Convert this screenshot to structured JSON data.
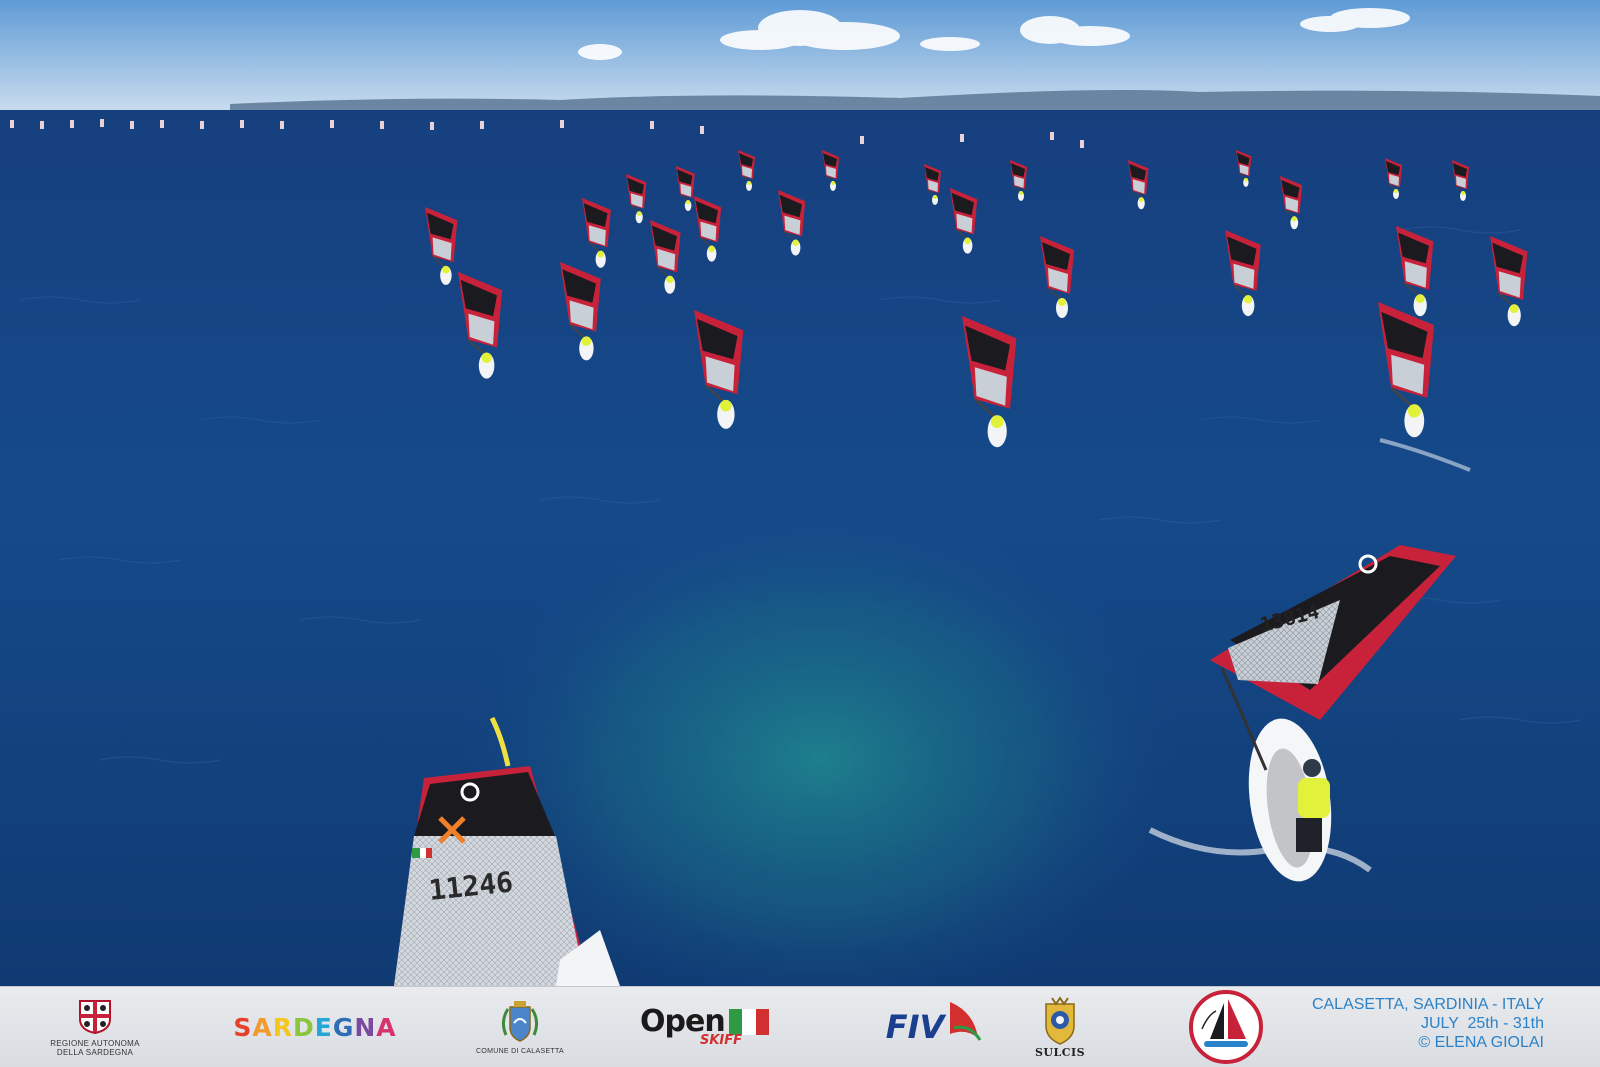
{
  "photo": {
    "subject": "aerial-view-of-windsurf-fleet-racing-on-open-sea",
    "colors": {
      "sky": "#7fb2df",
      "sea_deep": "#123f7a",
      "sea_shallow": "#1d7a86",
      "sail_red": "#c8223a",
      "sail_dark": "#1b1b1f",
      "jersey": "#e2f23a"
    },
    "near_sail_numbers": [
      "11246",
      "13814"
    ]
  },
  "banner": {
    "logos": {
      "region_line1": "REGIONE AUTONOMA",
      "region_line2": "DELLA SARDEGNA",
      "sardegna_letters": [
        "S",
        "A",
        "R",
        "D",
        "E",
        "G",
        "N",
        "A"
      ],
      "comune": "COMUNE DI CALASETTA",
      "open_word": "Open",
      "skiff_word": "SKIFF",
      "fiv": "FIV",
      "sulcis": "SULCIS",
      "championship_icon": "world-championship-badge-icon"
    },
    "event": {
      "location": "CALASETTA, SARDINIA - ITALY",
      "dates": "JULY  25th - 31th",
      "credit": "© ELENA GIOLAI"
    }
  }
}
